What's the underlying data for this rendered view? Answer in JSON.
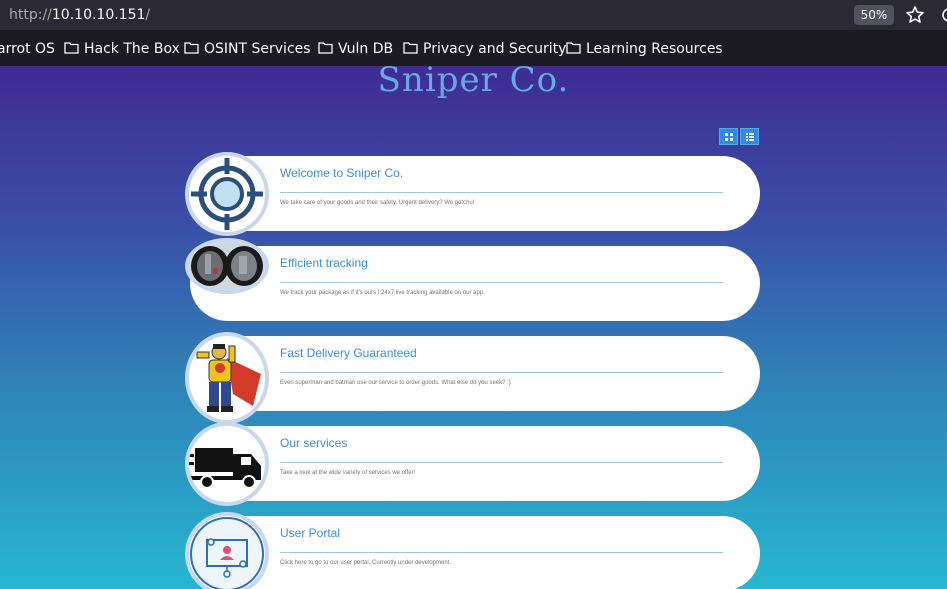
{
  "browser": {
    "url_protocol": "http://",
    "url_host": "10.10.10.151",
    "url_path": "/",
    "zoom": "50%",
    "bookmarks": [
      "arrot OS",
      "Hack The Box",
      "OSINT Services",
      "Vuln DB",
      "Privacy and Security",
      "Learning Resources"
    ]
  },
  "site": {
    "title": "Sniper Co.",
    "cards": [
      {
        "title": "Welcome to Sniper Co.",
        "text": "We take care of your goods and their safety. Urgent delivery? We gotchu!",
        "icon": "crosshair-icon"
      },
      {
        "title": "Efficient tracking",
        "text": "We track your package as if it's ours ! 24x7 live tracking available on our app.",
        "icon": "binoculars-photo-icon"
      },
      {
        "title": "Fast Delivery Guaranteed",
        "text": "Even superman and batman use our service to order goods. What else do you seek? ;)",
        "icon": "superhero-icon"
      },
      {
        "title": "Our services",
        "text": "Take a look at the wide variety of services we offer!",
        "icon": "delivery-truck-icon"
      },
      {
        "title": "User Portal",
        "text": "Click here to go to our user portal. Currently under development.",
        "icon": "user-network-icon"
      }
    ]
  },
  "colors": {
    "gradient_top": "#3f2b93",
    "gradient_bottom": "#26b7cf",
    "title": "#6aa7e8",
    "card_title": "#3a8fd8"
  }
}
